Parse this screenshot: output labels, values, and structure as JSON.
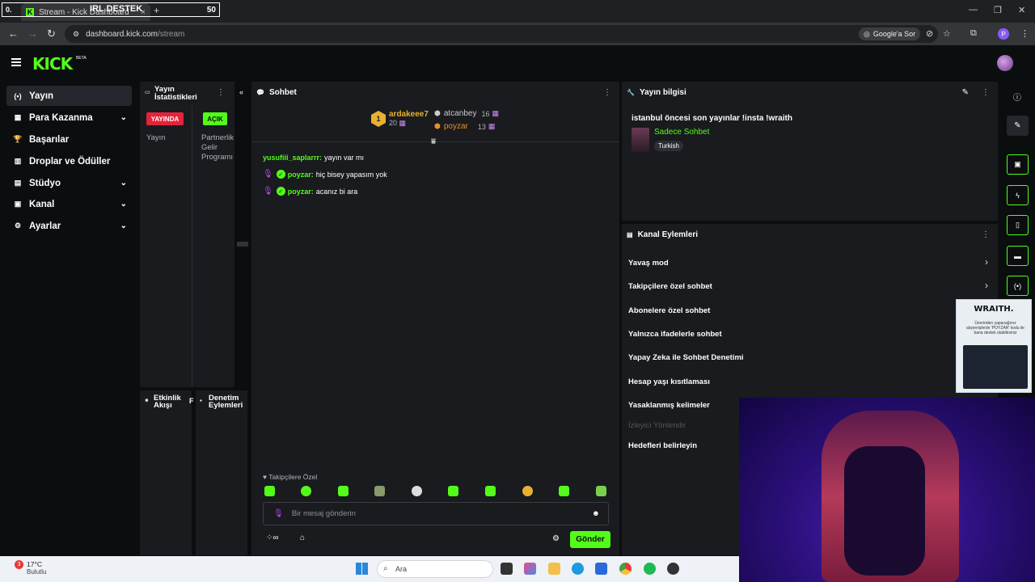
{
  "browser": {
    "overlay_left": "0.",
    "overlay_mid": "IRL DESTEK",
    "overlay_right": "50",
    "tab_title": "Stream - Kick Dashboard",
    "tab_close": "×",
    "new_tab": "+",
    "url_host": "dashboard.kick.com",
    "url_path": "/stream",
    "google_ask": "Google'a Sor",
    "profile_initial": "P"
  },
  "header": {
    "logo": "KICK",
    "beta": "BETA"
  },
  "sidebar": {
    "items": [
      {
        "label": "Yayın",
        "icon": "(•)"
      },
      {
        "label": "Para Kazanma",
        "icon": "▦"
      },
      {
        "label": "Başarılar",
        "icon": "🏆"
      },
      {
        "label": "Droplar ve Ödüller",
        "icon": "▥"
      },
      {
        "label": "Stüdyo",
        "icon": "▤"
      },
      {
        "label": "Kanal",
        "icon": "▣"
      },
      {
        "label": "Ayarlar",
        "icon": "⚙"
      }
    ]
  },
  "stats": {
    "title_line1": "Yayın",
    "title_line2": "İstatistikleri",
    "live_badge": "YAYINDA",
    "open_badge": "AÇIK",
    "label_stream": "Yayın",
    "label_partner_1": "Partnerlik",
    "label_partner_2": "Gelir",
    "label_partner_3": "Programı"
  },
  "activity": {
    "title_1": "Etkinlik",
    "title_2": "Akışı",
    "cut": "F"
  },
  "mod": {
    "title_1": "Denetim",
    "title_2": "Eylemleri"
  },
  "chat": {
    "title": "Sohbet",
    "top_gifters": [
      {
        "rank": "1",
        "name": "ardakeee7",
        "count": "20"
      },
      {
        "name": "atcanbey",
        "count": "16"
      },
      {
        "name": "poyzar",
        "count": "13"
      }
    ],
    "messages": [
      {
        "user": "yusufiii_saplarrr:",
        "text": "yayın var mı"
      },
      {
        "user": "poyzar:",
        "text": "hiç bisey yapasım yok"
      },
      {
        "user": "poyzar:",
        "text": "acanız bi ara"
      }
    ],
    "followers_only": "Takipçilere Özel",
    "input_placeholder": "Bir mesaj gönderin",
    "send_label": "Gönder"
  },
  "stream_info": {
    "title": "Yayın bilgisi",
    "stream_title": "istanbul öncesi son yayınlar !insta !wraith",
    "category": "Sadece Sohbet",
    "tag": "Turkish"
  },
  "channel_actions": {
    "title": "Kanal Eylemleri",
    "items": [
      "Yavaş mod",
      "Takipçilere özel sohbet",
      "Abonelere özel sohbet",
      "Yalnızca ifadelerle sohbet",
      "Yapay Zeka ile Sohbet Denetimi",
      "Hesap yaşı kısıtlaması",
      "Yasaklanmış kelimeler",
      "İzleyici Yönlendir",
      "Hedefleri belirleyin"
    ]
  },
  "ad": {
    "brand": "WRAITH.",
    "text": "Üzerinden yapacağınız alışverişlerde 'POYZAR' kodu ile bana destek olabilirsiniz"
  },
  "taskbar": {
    "weather_badge": "3",
    "temp": "17°C",
    "weather": "Bulutlu",
    "search": "Ara"
  },
  "colors": {
    "brand_green": "#53fc18",
    "live_red": "#e5233a",
    "panel": "#191b1f"
  }
}
